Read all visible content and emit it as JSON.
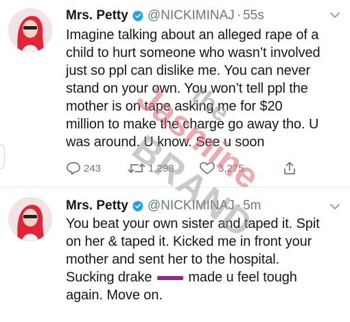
{
  "tweets": [
    {
      "name": "Mrs. Petty",
      "handle": "@NICKIMINAJ",
      "dot": "·",
      "time": "55s",
      "text": "Imagine talking about an alleged rape of a\nchild to hurt someone who wasn’t involved\njust so ppl can dislike me. You can never\nstand on your own. You won’t tell ppl the\nmother is on tape asking me for $20\nmillion to make the charge go away tho. U\nwas around. U know. See u soon",
      "replies": "243",
      "retweets": "1,298",
      "likes": "3,275"
    },
    {
      "name": "Mrs. Petty",
      "handle": "@NICKIMINAJ",
      "dot": "·",
      "time": "5m",
      "text_before": "You beat your own sister and taped it. Spit\non her & taped it. Kicked me in front your\nmother and sent her to the hospital.\nSucking drake ",
      "text_after": " made u feel tough\nagain. Move on."
    }
  ],
  "watermark": {
    "line1": "the",
    "line2": "Jasmine",
    "line3": "BRAND"
  },
  "colors": {
    "verified": "#1da1f2",
    "muted": "#657786",
    "divider": "#e1e8ed",
    "redaction": "#8e2c8f"
  },
  "icons": [
    "verified-badge-icon",
    "chevron-down-icon",
    "reply-icon",
    "retweet-icon",
    "like-icon",
    "share-icon"
  ]
}
